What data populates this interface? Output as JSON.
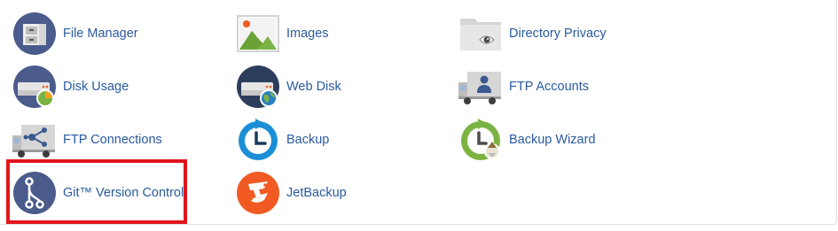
{
  "files_section": {
    "items": [
      {
        "label": "File Manager",
        "icon": "file-cabinet-icon"
      },
      {
        "label": "Images",
        "icon": "image-landscape-icon"
      },
      {
        "label": "Directory Privacy",
        "icon": "folder-eye-icon"
      },
      {
        "label": "Disk Usage",
        "icon": "disk-pie-icon"
      },
      {
        "label": "Web Disk",
        "icon": "disk-globe-icon"
      },
      {
        "label": "FTP Accounts",
        "icon": "truck-user-icon"
      },
      {
        "label": "FTP Connections",
        "icon": "truck-network-icon"
      },
      {
        "label": "Backup",
        "icon": "backup-clock-icon"
      },
      {
        "label": "Backup Wizard",
        "icon": "backup-wizard-icon"
      },
      {
        "label": "Git™ Version Control",
        "icon": "git-branch-icon"
      },
      {
        "label": "JetBackup",
        "icon": "jetbackup-icon"
      }
    ]
  },
  "colors": {
    "link": "#295a9e",
    "highlight_border": "#e0161c",
    "icon_navy": "#4a5b8c",
    "icon_blue": "#1b8fd6",
    "icon_green": "#7bb342",
    "icon_orange": "#f15a22"
  }
}
